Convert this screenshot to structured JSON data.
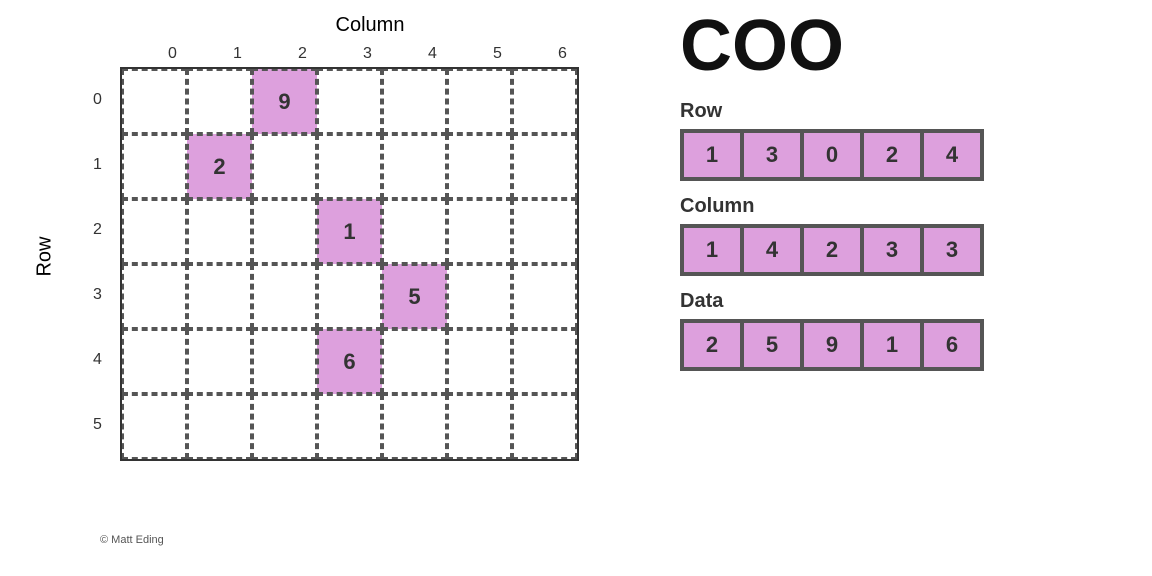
{
  "left": {
    "col_title": "Column",
    "row_label": "Row",
    "col_indices": [
      "0",
      "1",
      "2",
      "3",
      "4",
      "5",
      "6"
    ],
    "row_indices": [
      "0",
      "1",
      "2",
      "3",
      "4",
      "5"
    ],
    "highlighted_cells": [
      {
        "row": 0,
        "col": 2,
        "value": "9"
      },
      {
        "row": 1,
        "col": 1,
        "value": "2"
      },
      {
        "row": 2,
        "col": 3,
        "value": "1"
      },
      {
        "row": 3,
        "col": 4,
        "value": "5"
      },
      {
        "row": 4,
        "col": 3,
        "value": "6"
      }
    ],
    "copyright": "© Matt Eding"
  },
  "right": {
    "title": "COO",
    "row_section": {
      "label": "Row",
      "values": [
        "1",
        "3",
        "0",
        "2",
        "4"
      ]
    },
    "column_section": {
      "label": "Column",
      "values": [
        "1",
        "4",
        "2",
        "3",
        "3"
      ]
    },
    "data_section": {
      "label": "Data",
      "values": [
        "2",
        "5",
        "9",
        "1",
        "6"
      ]
    }
  }
}
